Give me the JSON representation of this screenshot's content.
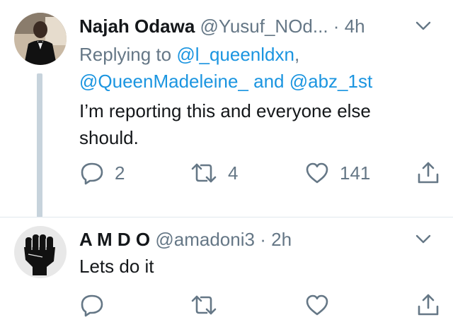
{
  "tweet1": {
    "name": "Najah Odawa",
    "handle": "@Yusuf_NOd...",
    "dot": "·",
    "time": "4h",
    "replying_prefix": "Replying to ",
    "mention1": "@l_queenldxn",
    "comma": ",",
    "mention2": "@QueenMadeleine_",
    "and": " and ",
    "mention3": "@abz_1st",
    "text_line1": "I’m reporting this and everyone else",
    "text_line2": "should.",
    "reply_count": "2",
    "retweet_count": "4",
    "like_count": "141"
  },
  "tweet2": {
    "name": "A M D O",
    "handle": "@amadoni3",
    "dot": "·",
    "time": "2h",
    "text": "Lets do it"
  },
  "colors": {
    "text": "#14171a",
    "secondary": "#657786",
    "link": "#1b95e0",
    "thread_line": "#c7d3dc",
    "divider": "#e1e8ed"
  },
  "icons": [
    "avatar",
    "chevron-down-icon",
    "reply-icon",
    "retweet-icon",
    "like-icon",
    "share-icon"
  ]
}
